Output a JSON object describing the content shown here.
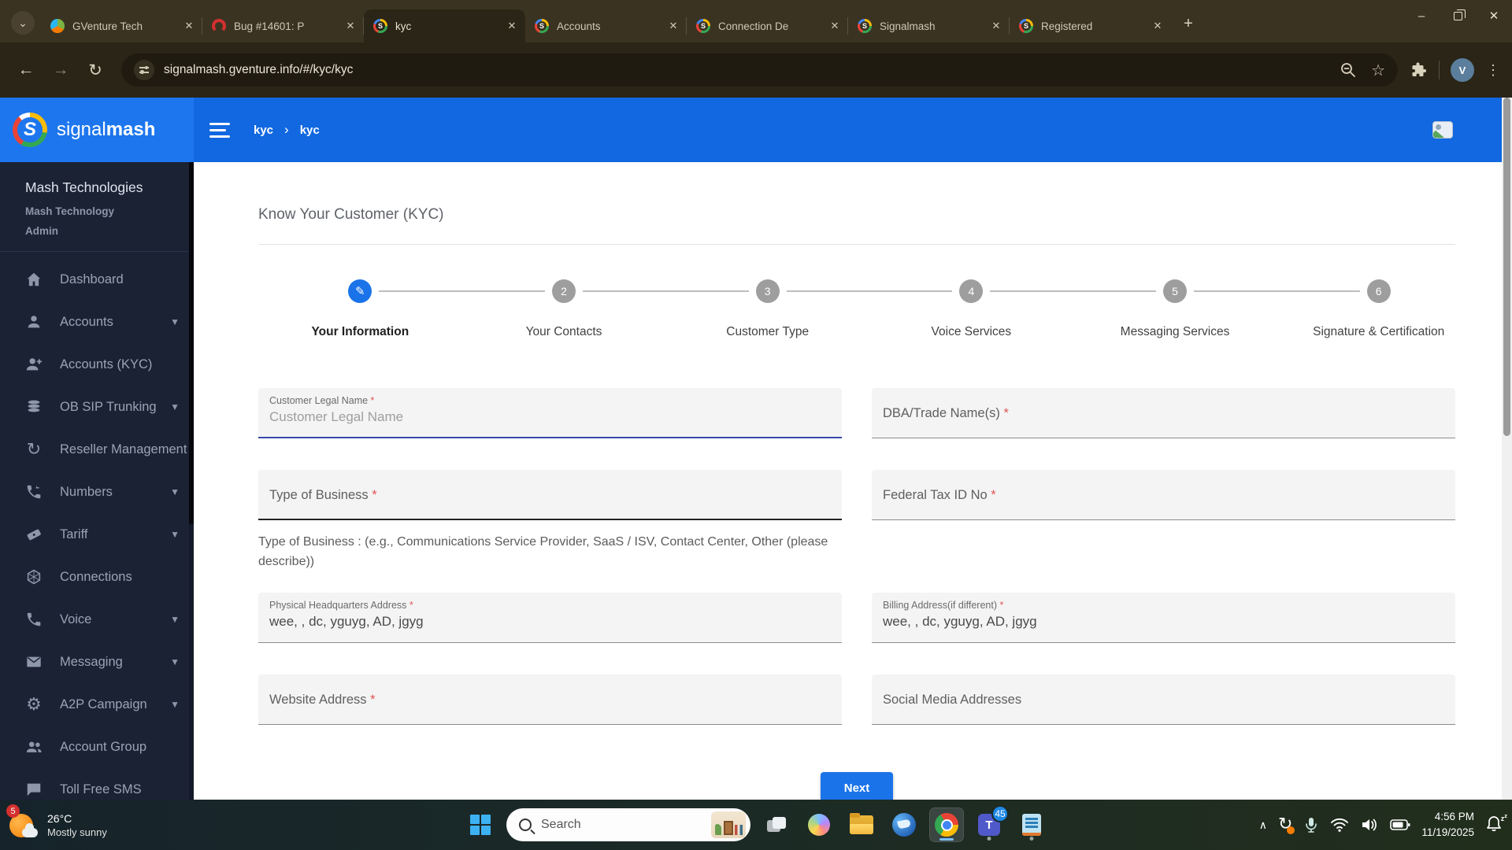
{
  "browser": {
    "tabs": [
      {
        "title": "GVenture Tech"
      },
      {
        "title": "Bug #14601: P"
      },
      {
        "title": "kyc"
      },
      {
        "title": "Accounts"
      },
      {
        "title": "Connection De"
      },
      {
        "title": "Signalmash"
      },
      {
        "title": "Registered"
      }
    ],
    "new_tab_label": "+",
    "close_glyph": "✕",
    "back_glyph": "←",
    "forward_glyph": "→",
    "reload_glyph": "↻",
    "url": "signalmash.gventure.info/#/kyc/kyc",
    "star_glyph": "☆",
    "kebab_glyph": "⋮",
    "profile_initial": "V",
    "minimize_glyph": "–",
    "tab_search_glyph": "⌄"
  },
  "sidebar": {
    "logo_signal": "signal",
    "logo_mash": "mash",
    "logo_letter": "S",
    "org": {
      "name": "Mash Technologies",
      "sub1": "Mash Technology",
      "sub2": "Admin"
    },
    "chevron_glyph": "▼",
    "items": [
      {
        "label": "Dashboard"
      },
      {
        "label": "Accounts"
      },
      {
        "label": "Accounts (KYC)"
      },
      {
        "label": "OB SIP Trunking"
      },
      {
        "label": "Reseller Management"
      },
      {
        "label": "Numbers"
      },
      {
        "label": "Tariff"
      },
      {
        "label": "Connections"
      },
      {
        "label": "Voice"
      },
      {
        "label": "Messaging"
      },
      {
        "label": "A2P Campaign"
      },
      {
        "label": "Account Group"
      },
      {
        "label": "Toll Free SMS"
      }
    ],
    "sync_glyph": "↻",
    "gear_glyph": "⚙"
  },
  "appbar": {
    "crumb1": "kyc",
    "separator": "›",
    "crumb2": "kyc"
  },
  "kyc": {
    "title": "Know Your Customer (KYC)",
    "steps": [
      {
        "num": "✎",
        "label": "Your Information"
      },
      {
        "num": "2",
        "label": "Your Contacts"
      },
      {
        "num": "3",
        "label": "Customer Type"
      },
      {
        "num": "4",
        "label": "Voice Services"
      },
      {
        "num": "5",
        "label": "Messaging Services"
      },
      {
        "num": "6",
        "label": "Signature & Certification"
      }
    ],
    "required_marker": "*",
    "fields": {
      "customer_legal_name": {
        "label": "Customer Legal Name",
        "placeholder": "Customer Legal Name"
      },
      "dba": {
        "label": "DBA/Trade Name(s)"
      },
      "type_of_business": {
        "label": "Type of Business"
      },
      "federal_tax": {
        "label": "Federal Tax ID No"
      },
      "hq_address": {
        "label": "Physical Headquarters Address",
        "value": "wee, , dc, yguyg, AD, jgyg"
      },
      "billing_address": {
        "label": "Billing Address(if different)",
        "value": "wee, , dc, yguyg, AD, jgyg"
      },
      "website": {
        "label": "Website Address"
      },
      "social": {
        "label": "Social Media Addresses"
      }
    },
    "business_hint": "Type of Business : (e.g., Communications Service Provider, SaaS / ISV, Contact Center, Other (please describe))",
    "next_label": "Next"
  },
  "taskbar": {
    "weather": {
      "badge": "5",
      "temp": "26°C",
      "condition": "Mostly sunny"
    },
    "search_placeholder": "Search",
    "teams_label": "T",
    "teams_badge": "45",
    "tray_chevron": "∧",
    "time": "4:56 PM",
    "date": "11/19/2025"
  },
  "colors": {
    "accent_blue": "#1a73e8",
    "appbar_blue": "#1168e0",
    "sidebar_navy": "#1b2234",
    "focus_underline": "#3949ab",
    "required_red": "#e25555"
  }
}
